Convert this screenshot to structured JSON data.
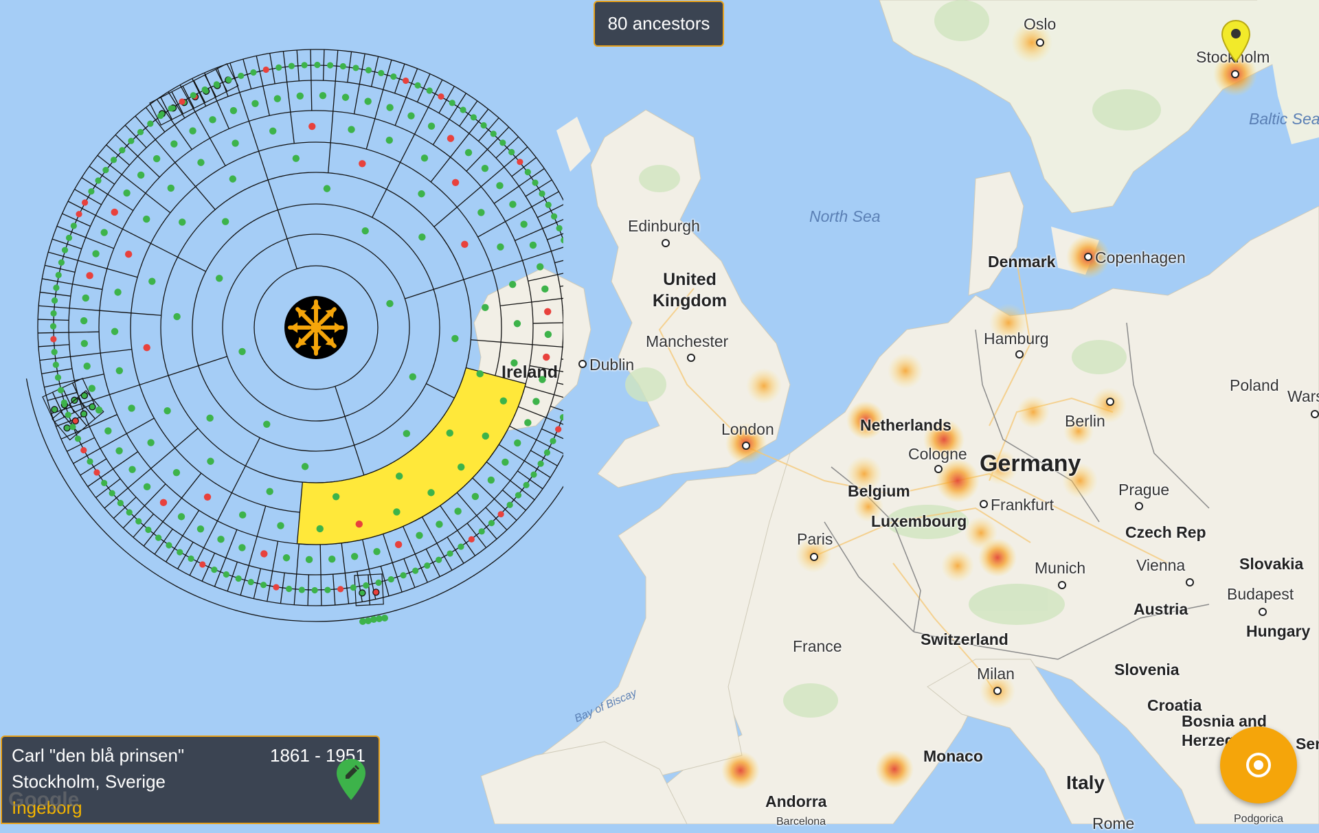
{
  "header": {
    "ancestor_count": "80 ancestors"
  },
  "person": {
    "name": "Carl \"den blå prinsen\"",
    "years": "1861 - 1951",
    "place": "Stockholm, Sverige",
    "relation": "Ingeborg"
  },
  "map": {
    "attribution": "Google",
    "labels": {
      "oslo": "Oslo",
      "stockholm": "Stockholm",
      "baltic": "Baltic Sea",
      "north_sea": "North Sea",
      "edinburgh": "Edinburgh",
      "denmark": "Denmark",
      "copenhagen": "Copenhagen",
      "uk": "United Kingdom",
      "manchester": "Manchester",
      "hamburg": "Hamburg",
      "dublin": "Dublin",
      "ireland": "Ireland",
      "poland": "Poland",
      "warsaw": "Wars",
      "berlin": "Berlin",
      "london": "London",
      "netherlands": "Netherlands",
      "cologne": "Cologne",
      "germany": "Germany",
      "belgium": "Belgium",
      "prague": "Prague",
      "frankfurt": "Frankfurt",
      "luxembourg": "Luxembourg",
      "czech": "Czech Rep",
      "slovakia": "Slovakia",
      "paris": "Paris",
      "munich": "Munich",
      "vienna": "Vienna",
      "budapest": "Budapest",
      "austria": "Austria",
      "hungary": "Hungary",
      "france": "France",
      "switzerland": "Switzerland",
      "milan": "Milan",
      "slovenia": "Slovenia",
      "croatia": "Croatia",
      "bay_biscay": "Bay of Biscay",
      "monaco": "Monaco",
      "bosnia": "Bosnia and Herzeg",
      "serbia": "Serb",
      "andorra": "Andorra",
      "italy": "Italy",
      "rome": "Rome",
      "podgorica": "Podgorica",
      "barcelona": "Barcelona"
    }
  },
  "colors": {
    "water": "#a5cdf6",
    "land": "#f2efe6",
    "accent": "#f5a50a",
    "panel": "#3b4452",
    "found": "#3db34a",
    "missing": "#e8413c",
    "selected_segment": "#ffe83a"
  },
  "icons": {
    "center": "sun-icon",
    "edit": "edit-pin-icon",
    "locate": "locate-icon",
    "marker": "map-marker-icon"
  }
}
